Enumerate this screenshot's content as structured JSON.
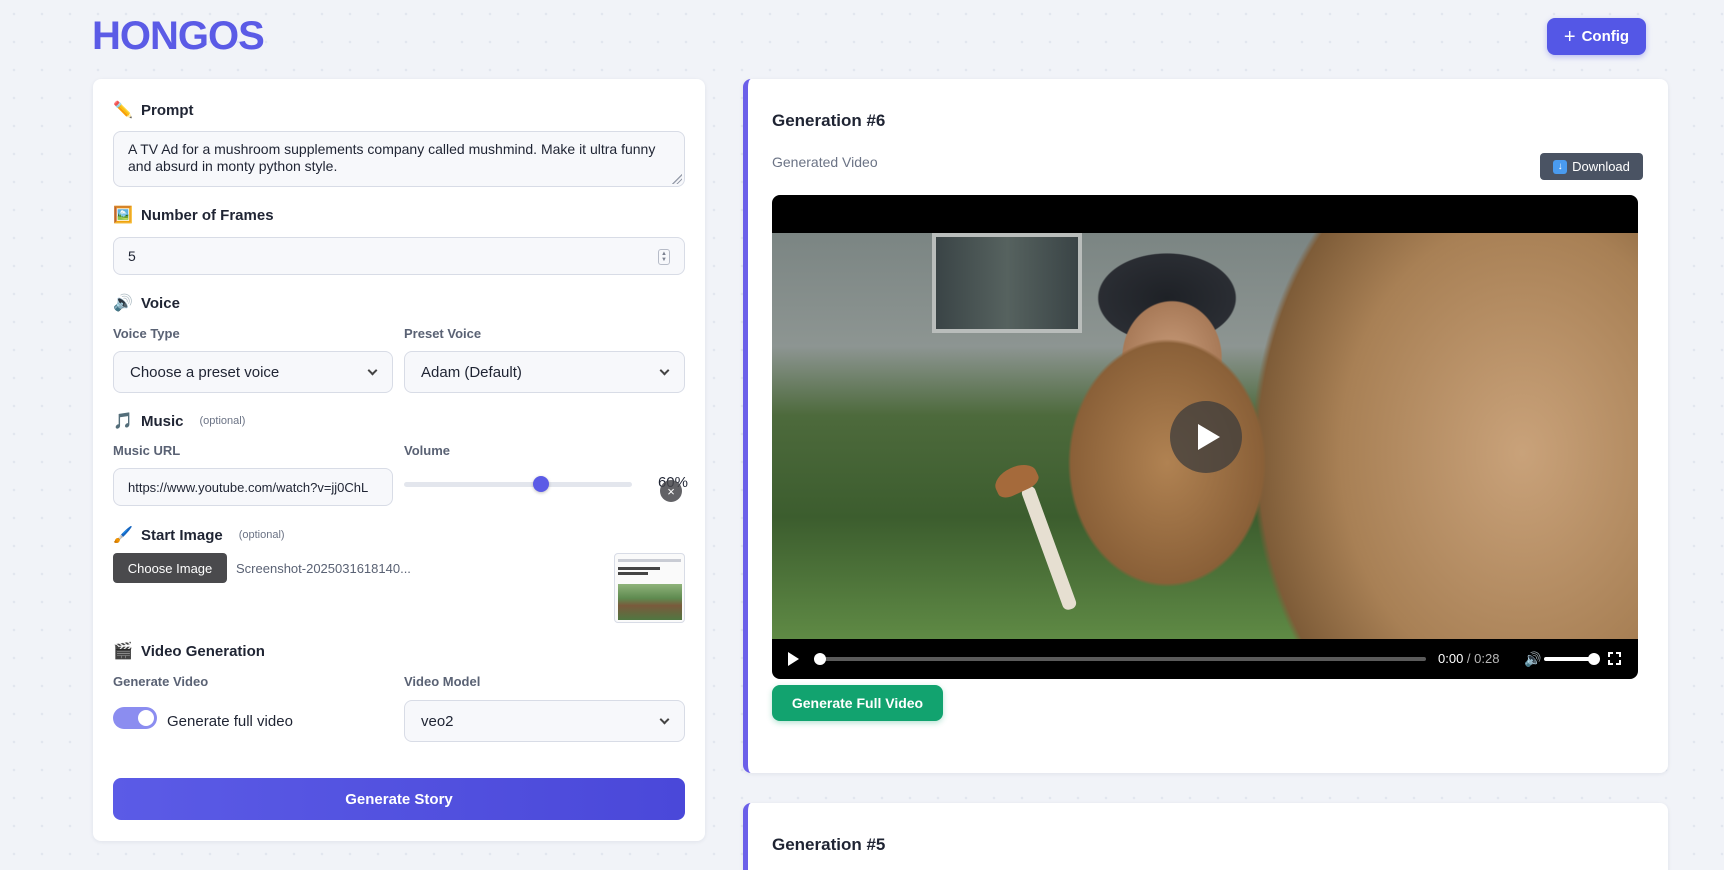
{
  "header": {
    "logo": "HONGOS",
    "config_label": "Config"
  },
  "prompt": {
    "title": "Prompt",
    "emoji": "✏️",
    "value": "A TV Ad for a mushroom supplements company called mushmind. Make it ultra funny and absurd in monty python style."
  },
  "frames": {
    "title": "Number of Frames",
    "emoji": "🖼️",
    "value": "5"
  },
  "voice": {
    "title": "Voice",
    "emoji": "🔊",
    "type_label": "Voice Type",
    "type_value": "Choose a preset voice",
    "preset_label": "Preset Voice",
    "preset_value": "Adam (Default)"
  },
  "music": {
    "title": "Music",
    "emoji": "🎵",
    "optional": "(optional)",
    "url_label": "Music URL",
    "url_value": "https://www.youtube.com/watch?v=jj0ChL",
    "volume_label": "Volume",
    "volume_text": "60%",
    "volume_fraction": 0.6
  },
  "start_image": {
    "title": "Start Image",
    "emoji": "🖌️",
    "optional": "(optional)",
    "choose_label": "Choose Image",
    "file_name": "Screenshot-2025031618140...",
    "close_glyph": "×"
  },
  "video_generation": {
    "title": "Video Generation",
    "emoji": "🎬",
    "generate_label": "Generate Video",
    "toggle_label": "Generate full video",
    "toggle_on": true,
    "model_label": "Video Model",
    "model_value": "veo2"
  },
  "generate_story_label": "Generate Story",
  "generations": [
    {
      "title": "Generation #6",
      "subtitle": "Generated Video",
      "download_label": "Download",
      "time_current": "0:00",
      "time_sep": " / ",
      "time_total": "0:28",
      "full_video_label": "Generate Full Video"
    },
    {
      "title": "Generation #5"
    }
  ],
  "colors": {
    "accent": "#5b5be6",
    "success": "#12a36f",
    "card_border": "#6b5fe9"
  }
}
